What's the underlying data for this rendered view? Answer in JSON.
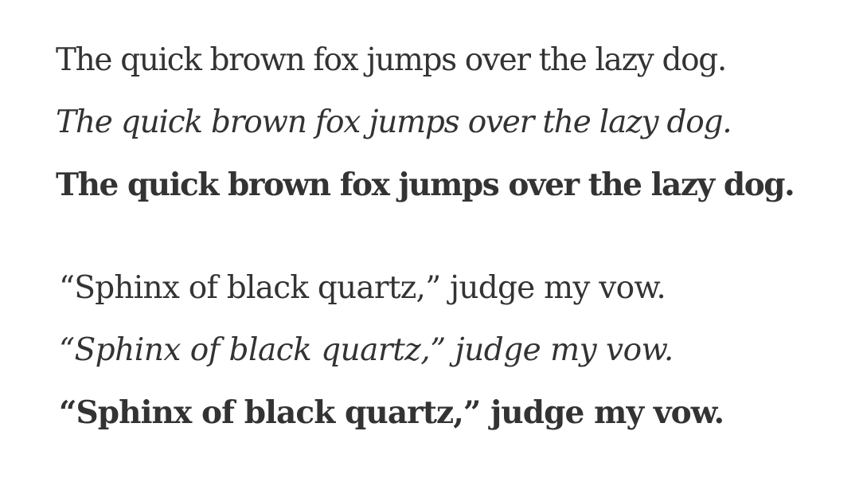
{
  "samples": {
    "pangram": {
      "regular": "The quick brown fox jumps over the lazy dog.",
      "italic": "The quick brown fox jumps over the lazy dog.",
      "bold": "The quick brown fox jumps over the lazy dog."
    },
    "sphinx": {
      "regular": "“Sphinx of black quartz,” judge my vow.",
      "italic": "“Sphinx of black quartz,” judge my vow.",
      "bold": "“Sphinx of black quartz,” judge my vow."
    }
  },
  "colors": {
    "text": "#333333",
    "background": "#ffffff"
  }
}
